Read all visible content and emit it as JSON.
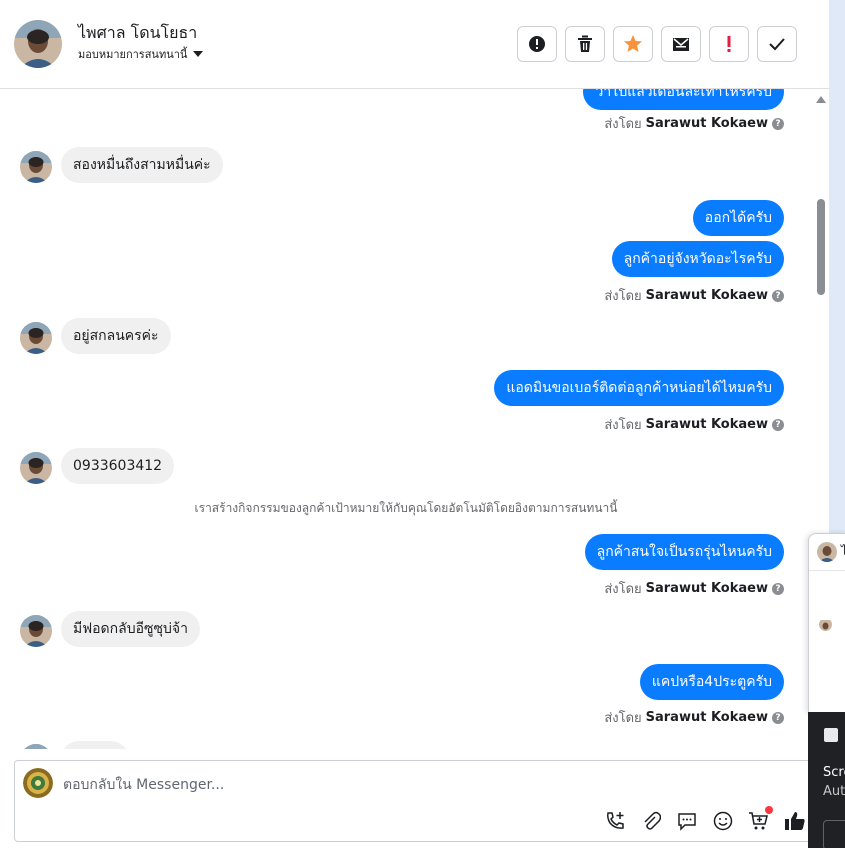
{
  "header": {
    "contact_name": "ไพศาล โดนโยธา",
    "assign_label": "มอบหมายการสนทนานี้"
  },
  "sent_by": {
    "prefix": "ส่งโดย",
    "agent": "Sarawut Kokaew",
    "help": "?"
  },
  "messages": {
    "m0": "ว่าไปแล้วเดือนละเท่าไหร่ครับ",
    "m1": "สองหมื่นถึงสามหมื่นค่ะ",
    "m2": "ออกได้ครับ",
    "m3": "ลูกค้าอยู่จังหวัดอะไรครับ",
    "m4": "อยู่สกลนครค่ะ",
    "m5": "แอดมินขอเบอร์ติดต่อลูกค้าหน่อยได้ไหมครับ",
    "m6": "0933603412",
    "m7": "ลูกค้าสนใจเป็นรถรุ่นไหนครับ",
    "m8": "มีฟอดกลับอีซูซุบ่จ้า",
    "m9": "แคปหรือ4ประตูครับ"
  },
  "system_note": "เราสร้างกิจกรรมของลูกค้าเป้าหมายให้กับคุณโดยอัตโนมัติโดยอิงตามการสนทนานี้",
  "composer": {
    "placeholder": "ตอบกลับใน Messenger..."
  },
  "popup": {
    "text": "ไ"
  },
  "dark_panel": {
    "line1": "Scre",
    "line2": "Aut"
  },
  "colors": {
    "outgoing": "#0a7cff",
    "incoming": "#f0f0f0",
    "star": "#f7923b",
    "alert": "#e41e3f"
  }
}
